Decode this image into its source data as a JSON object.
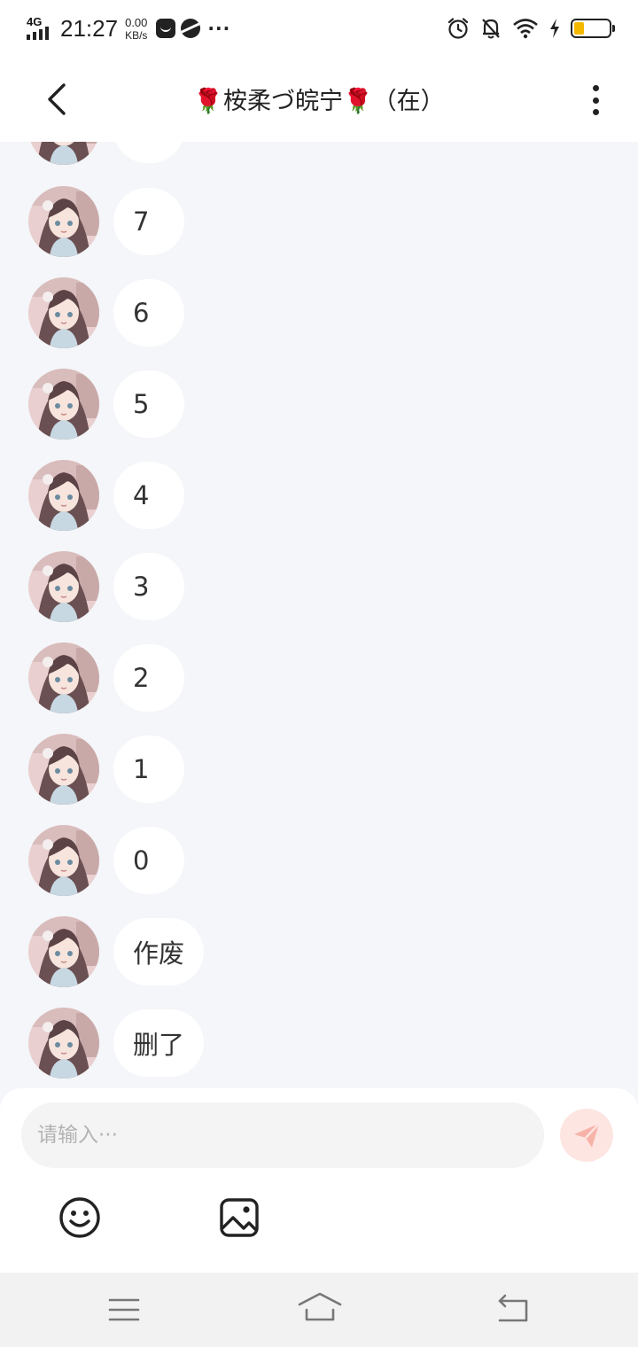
{
  "status_bar": {
    "network": "4G",
    "time": "21:27",
    "speed_value": "0.00",
    "speed_unit": "KB/s",
    "more": "···",
    "battery_level": 0.3
  },
  "header": {
    "title": "🌹桉柔づ皖宁🌹（在）"
  },
  "messages": [
    {
      "text": ""
    },
    {
      "text": "7"
    },
    {
      "text": "6"
    },
    {
      "text": "5"
    },
    {
      "text": "4"
    },
    {
      "text": "3"
    },
    {
      "text": "2"
    },
    {
      "text": "1"
    },
    {
      "text": "0"
    },
    {
      "text": "作废"
    },
    {
      "text": "删了"
    }
  ],
  "composer": {
    "placeholder": "请输入···"
  },
  "colors": {
    "background": "#f4f6f9",
    "bubble": "#ffffff",
    "send_button": "#fde5e2",
    "send_icon": "#f7b3a8"
  }
}
